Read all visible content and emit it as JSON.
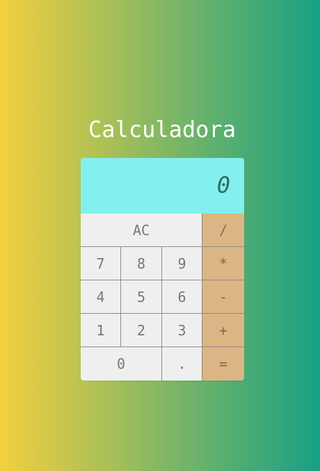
{
  "app": {
    "title": "Calculadora"
  },
  "display": {
    "value": "0"
  },
  "keys": {
    "ac": "AC",
    "divide": "/",
    "seven": "7",
    "eight": "8",
    "nine": "9",
    "multiply": "*",
    "four": "4",
    "five": "5",
    "six": "6",
    "minus": "-",
    "one": "1",
    "two": "2",
    "three": "3",
    "plus": "+",
    "zero": "0",
    "dot": ".",
    "equals": "="
  },
  "colors": {
    "gradient_start": "#f4d03f",
    "gradient_end": "#16a085",
    "display_bg": "#83f0ef",
    "key_bg": "#efefef",
    "operator_bg": "#dcb585"
  }
}
